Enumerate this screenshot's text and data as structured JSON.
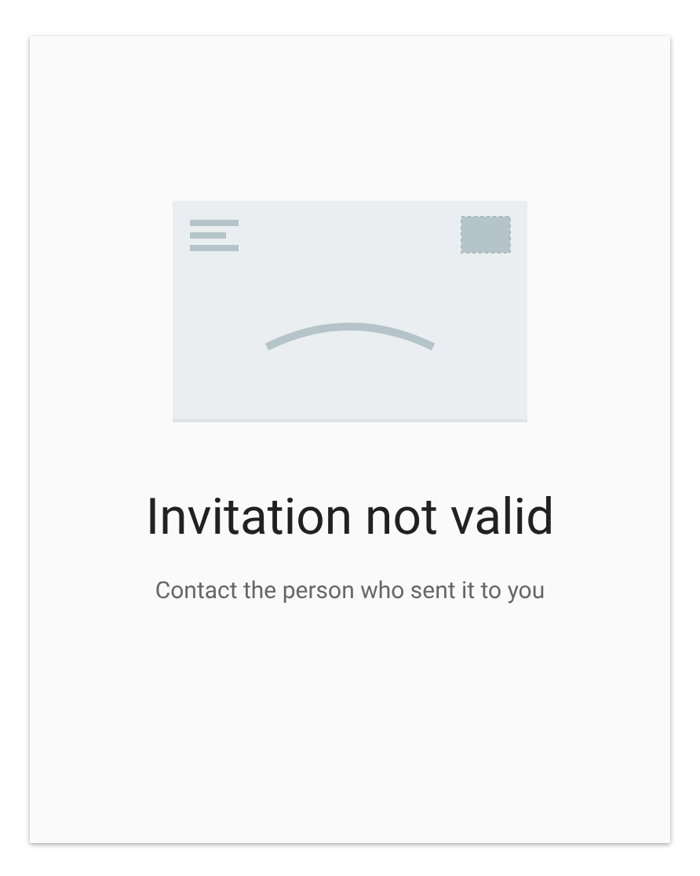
{
  "message": {
    "title": "Invitation not valid",
    "subtitle": "Contact the person who sent it to you"
  }
}
